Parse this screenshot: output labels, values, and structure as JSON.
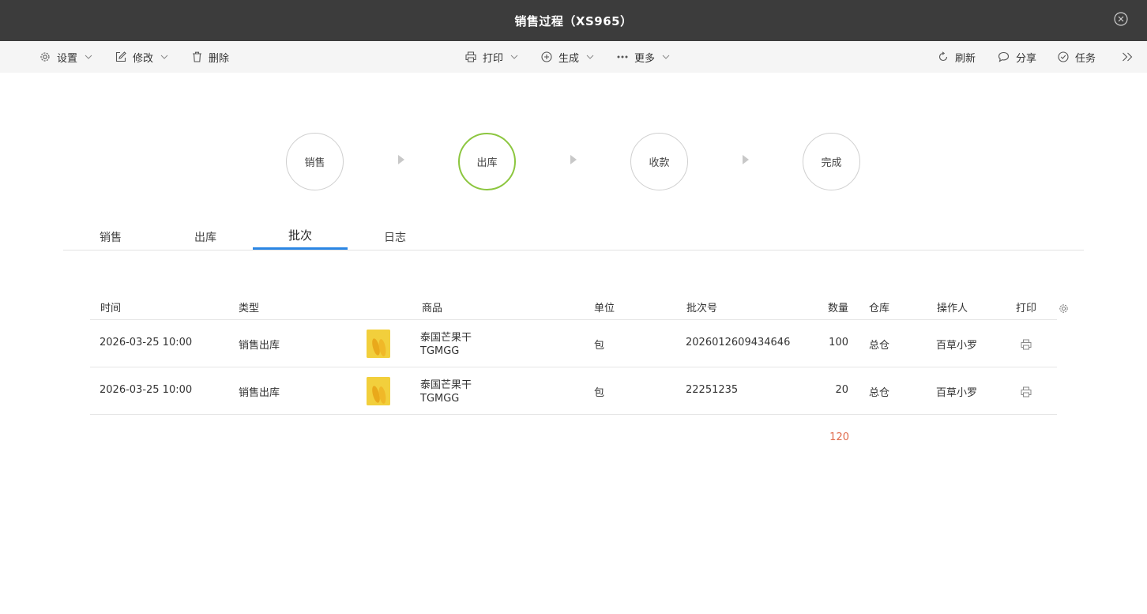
{
  "window": {
    "title": "销售过程（XS965）"
  },
  "toolbar": {
    "settings": "设置",
    "edit": "修改",
    "delete": "删除",
    "print": "打印",
    "generate": "生成",
    "more": "更多",
    "refresh": "刷新",
    "share": "分享",
    "task": "任务"
  },
  "flow": {
    "steps": [
      "销售",
      "出库",
      "收款",
      "完成"
    ],
    "active_index": 1
  },
  "tabs": {
    "items": [
      "销售",
      "出库",
      "批次",
      "日志"
    ],
    "active_index": 2
  },
  "table": {
    "headers": {
      "time": "时间",
      "type": "类型",
      "product": "商品",
      "unit": "单位",
      "batch": "批次号",
      "qty": "数量",
      "warehouse": "仓库",
      "operator": "操作人",
      "print": "打印"
    },
    "rows": [
      {
        "time": "2026-03-25 10:00",
        "type": "销售出库",
        "product_name": "泰国芒果干",
        "product_code": "TGMGG",
        "unit": "包",
        "batch": "2026012609434646",
        "qty": "100",
        "warehouse": "总仓",
        "operator": "百草小罗"
      },
      {
        "time": "2026-03-25 10:00",
        "type": "销售出库",
        "product_name": "泰国芒果干",
        "product_code": "TGMGG",
        "unit": "包",
        "batch": "22251235",
        "qty": "20",
        "warehouse": "总仓",
        "operator": "百草小罗"
      }
    ],
    "total_qty": "120"
  },
  "colors": {
    "active_step": "#8cc63f",
    "active_tab": "#2b86e4",
    "total": "#e06c4d",
    "titlebar": "#3c3c3c"
  }
}
